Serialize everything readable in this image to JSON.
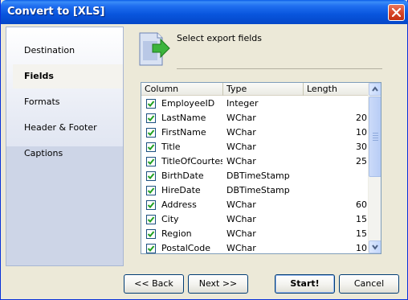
{
  "window": {
    "title": "Convert to [XLS]"
  },
  "sidebar": {
    "items": [
      {
        "label": "Destination"
      },
      {
        "label": "Fields",
        "active": true
      },
      {
        "label": "Formats"
      },
      {
        "label": "Header & Footer"
      },
      {
        "label": "Captions"
      }
    ]
  },
  "content": {
    "header_text": "Select export fields",
    "icon": "export-arrow-icon"
  },
  "grid": {
    "columns": [
      "Column",
      "Type",
      "Length"
    ],
    "rows": [
      {
        "checked": true,
        "column": "EmployeeID",
        "type": "Integer",
        "length": ""
      },
      {
        "checked": true,
        "column": "LastName",
        "type": "WChar",
        "length": "20"
      },
      {
        "checked": true,
        "column": "FirstName",
        "type": "WChar",
        "length": "10"
      },
      {
        "checked": true,
        "column": "Title",
        "type": "WChar",
        "length": "30"
      },
      {
        "checked": true,
        "column": "TitleOfCourtesy",
        "type": "WChar",
        "length": "25"
      },
      {
        "checked": true,
        "column": "BirthDate",
        "type": "DBTimeStamp",
        "length": ""
      },
      {
        "checked": true,
        "column": "HireDate",
        "type": "DBTimeStamp",
        "length": ""
      },
      {
        "checked": true,
        "column": "Address",
        "type": "WChar",
        "length": "60"
      },
      {
        "checked": true,
        "column": "City",
        "type": "WChar",
        "length": "15"
      },
      {
        "checked": true,
        "column": "Region",
        "type": "WChar",
        "length": "15"
      },
      {
        "checked": true,
        "column": "PostalCode",
        "type": "WChar",
        "length": "10"
      }
    ]
  },
  "buttons": {
    "back": "<< Back",
    "next": "Next >>",
    "start": "Start!",
    "cancel": "Cancel"
  },
  "colors": {
    "titlebar": "#0855dd",
    "check": "#21a121"
  }
}
